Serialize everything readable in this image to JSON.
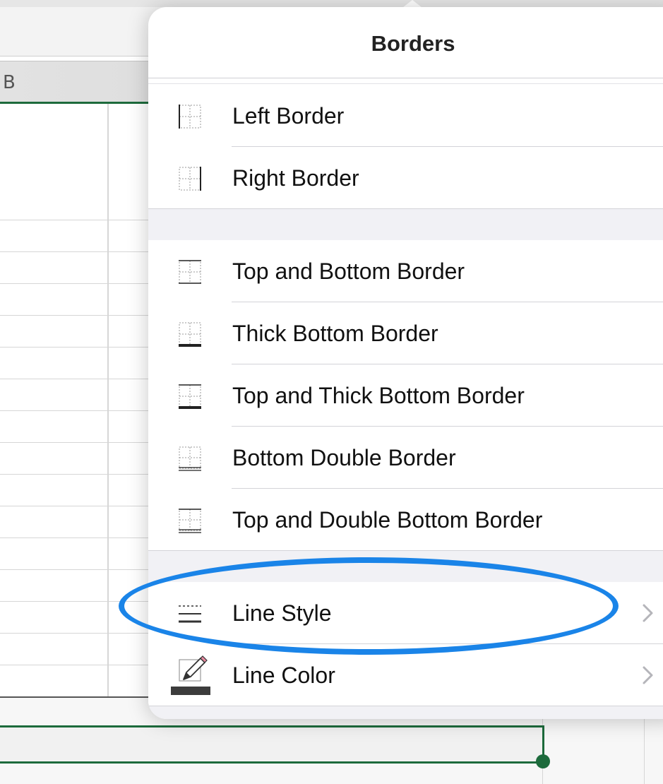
{
  "sheet": {
    "column_header_label": "B"
  },
  "popover": {
    "title": "Borders",
    "sections": [
      {
        "items": [
          {
            "label": "Left Border",
            "icon": "left-border-icon"
          },
          {
            "label": "Right Border",
            "icon": "right-border-icon"
          }
        ]
      },
      {
        "items": [
          {
            "label": "Top and Bottom Border",
            "icon": "top-bottom-border-icon"
          },
          {
            "label": "Thick Bottom Border",
            "icon": "thick-bottom-border-icon"
          },
          {
            "label": "Top and Thick Bottom Border",
            "icon": "top-thick-bottom-border-icon"
          },
          {
            "label": "Bottom Double Border",
            "icon": "bottom-double-border-icon"
          },
          {
            "label": "Top and Double Bottom Border",
            "icon": "top-double-bottom-border-icon"
          }
        ]
      },
      {
        "items": [
          {
            "label": "Line Style",
            "icon": "line-style-icon",
            "has_submenu": true
          },
          {
            "label": "Line Color",
            "icon": "line-color-icon",
            "has_submenu": true
          }
        ]
      }
    ]
  },
  "annotation": {
    "target": "Line Style",
    "color": "#1a84e8"
  },
  "colors": {
    "excel_green": "#1d6b3c",
    "annotation_blue": "#1a84e8",
    "pencil_tip_pink": "#e88aa0"
  }
}
